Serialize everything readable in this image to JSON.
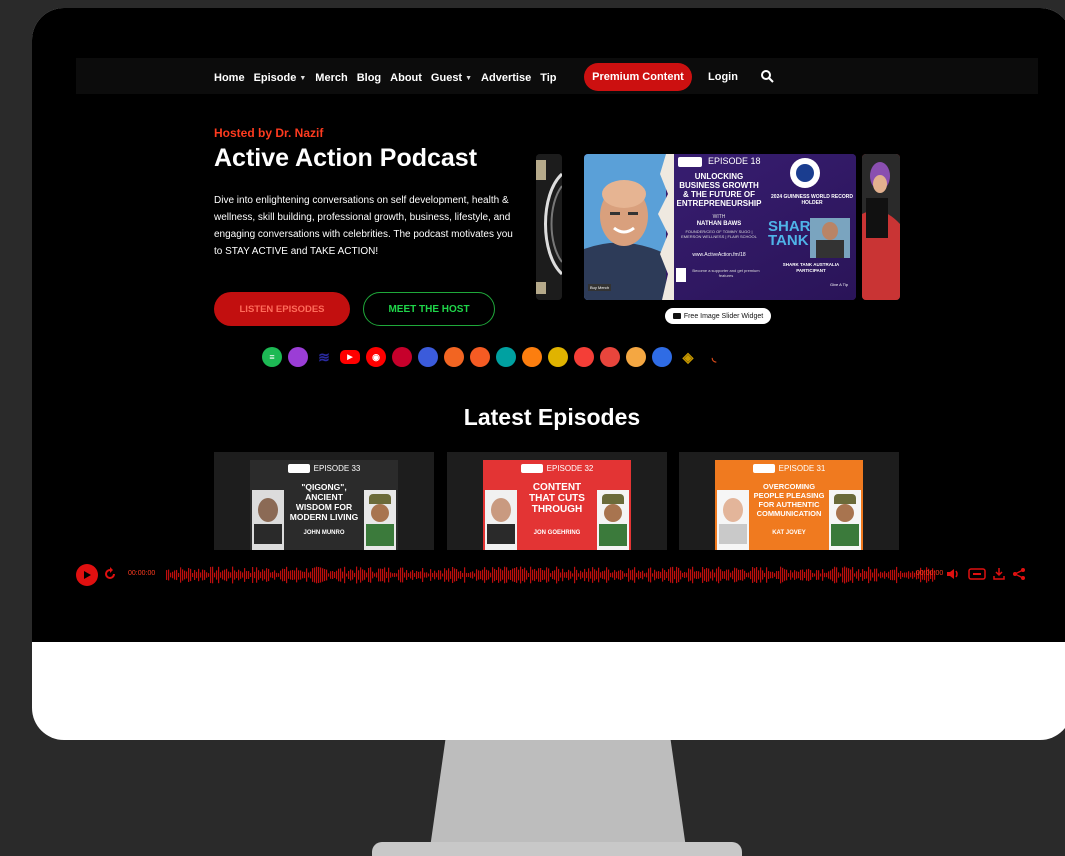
{
  "nav": {
    "items": [
      {
        "label": "Home",
        "dropdown": false
      },
      {
        "label": "Episode",
        "dropdown": true
      },
      {
        "label": "Merch",
        "dropdown": false
      },
      {
        "label": "Blog",
        "dropdown": false
      },
      {
        "label": "About",
        "dropdown": false
      },
      {
        "label": "Guest",
        "dropdown": true
      },
      {
        "label": "Advertise",
        "dropdown": false
      },
      {
        "label": "Tip",
        "dropdown": false
      }
    ],
    "premium_label": "Premium Content",
    "login_label": "Login",
    "search_icon": "search-icon"
  },
  "hero": {
    "hosted_by": "Hosted by Dr. Nazif",
    "title": "Active Action Podcast",
    "description": "Dive into enlightening conversations on self development, health & wellness, skill building, professional growth, business, lifestyle, and engaging conversations with celebrities. The podcast motivates you to STAY ACTIVE and TAKE ACTION!",
    "listen_label": "LISTEN EPISODES",
    "meet_label": "MEET THE HOST"
  },
  "slider": {
    "episode": "EPISODE 18",
    "title": "UNLOCKING BUSINESS GROWTH & THE FUTURE OF ENTREPRENEURSHIP",
    "with": "WITH",
    "guest": "NATHAN BAWS",
    "guest_role": "FOUNDER/CEO OF TOMMY SUGO | EMERSON WELLNESS | FLAIR SCHOOL",
    "url": "www.ActiveAction.fm/18",
    "record_title": "2024 GUINNESS WORLD RECORD HOLDER",
    "shark_tank": "SHARK TANK",
    "shark_caption": "SHARK TANK AUSTRALIA PARTICIPANT",
    "supporter": "Become a supporter and get premium features",
    "buy_merch": "Buy Merch",
    "give_tip": "Give A Tip",
    "widget_label": "Free Image Slider Widget"
  },
  "platforms": [
    {
      "name": "spotify-icon",
      "color": "#1DB954"
    },
    {
      "name": "apple-podcasts-icon",
      "color": "#9b3dd6"
    },
    {
      "name": "amazon-music-icon",
      "color": "#2a2aa0"
    },
    {
      "name": "youtube-icon",
      "color": "#ff0000"
    },
    {
      "name": "youtube-music-icon",
      "color": "#ff0000"
    },
    {
      "name": "iheartradio-icon",
      "color": "#c6002b"
    },
    {
      "name": "podcast-addict-icon",
      "color": "#3b5bdb"
    },
    {
      "name": "rss-icon",
      "color": "#f26522"
    },
    {
      "name": "castbox-icon",
      "color": "#f55b23"
    },
    {
      "name": "pocket-casts-icon",
      "color": "#00a1a1"
    },
    {
      "name": "overcast-icon",
      "color": "#fc7e0f"
    },
    {
      "name": "podchaser-icon",
      "color": "#e0b300"
    },
    {
      "name": "pocketcasts-red-icon",
      "color": "#f43e37"
    },
    {
      "name": "podcast-republic-icon",
      "color": "#e8453c"
    },
    {
      "name": "castro-icon",
      "color": "#f4a742"
    },
    {
      "name": "podcast-guru-icon",
      "color": "#2f6ce5"
    },
    {
      "name": "player-fm-icon",
      "color": "#c99a00"
    },
    {
      "name": "rss-small-icon",
      "color": "#e04c1a"
    }
  ],
  "latest": {
    "heading": "Latest Episodes",
    "episodes": [
      {
        "number": "EPISODE 33",
        "title": "\"QIGONG\", ANCIENT WISDOM FOR MODERN LIVING",
        "guest": "JOHN MUNRO",
        "bg": "#2b2b2b",
        "title_color": "#ffffff"
      },
      {
        "number": "EPISODE 32",
        "title": "CONTENT THAT CUTS THROUGH",
        "guest": "JON GOEHRING",
        "bg": "#e33434",
        "title_color": "#ffffff"
      },
      {
        "number": "EPISODE 31",
        "title": "OVERCOMING PEOPLE PLEASING FOR AUTHENTIC COMMUNICATION",
        "guest": "KAT JOVEY",
        "bg": "#f07a1f",
        "title_color": "#ffffff"
      }
    ]
  },
  "player": {
    "time_start": "00:00:00",
    "time_end": "00:00:00",
    "accent": "#e01010"
  }
}
